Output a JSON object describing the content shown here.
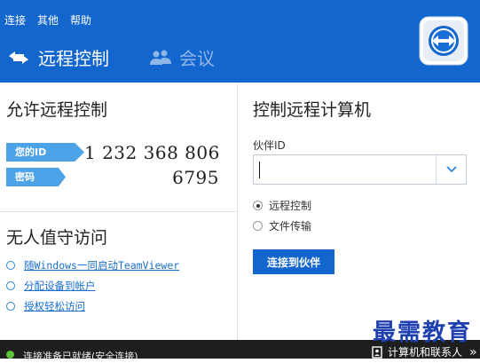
{
  "menu": {
    "items": [
      "连接",
      "其他",
      "帮助"
    ]
  },
  "tabs": {
    "remote_control": "远程控制",
    "meeting": "会议"
  },
  "allow": {
    "title": "允许远程控制",
    "id_label": "您的ID",
    "id_value": "1 232 368 806",
    "password_label": "密码",
    "password_value": "6795"
  },
  "unattended": {
    "title": "无人值守访问",
    "links": [
      "随Windows一同启动TeamViewer",
      "分配设备到帐户",
      "授权轻松访问"
    ]
  },
  "control": {
    "title": "控制远程计算机",
    "partner_label": "伙伴ID",
    "partner_value": "",
    "options": [
      "远程控制",
      "文件传输"
    ],
    "selected_option": "远程控制",
    "connect_button": "连接到伙伴"
  },
  "status": {
    "text": "连接准备已就绪(安全连接)",
    "contacts_label": "计算机和联系人",
    "contacts_chevron": "»"
  },
  "watermark": "最需教育",
  "colors": {
    "brand": "#1466cf",
    "badge": "#4da3e8",
    "link": "#1a6fce",
    "status_ok": "#5cc33a"
  }
}
